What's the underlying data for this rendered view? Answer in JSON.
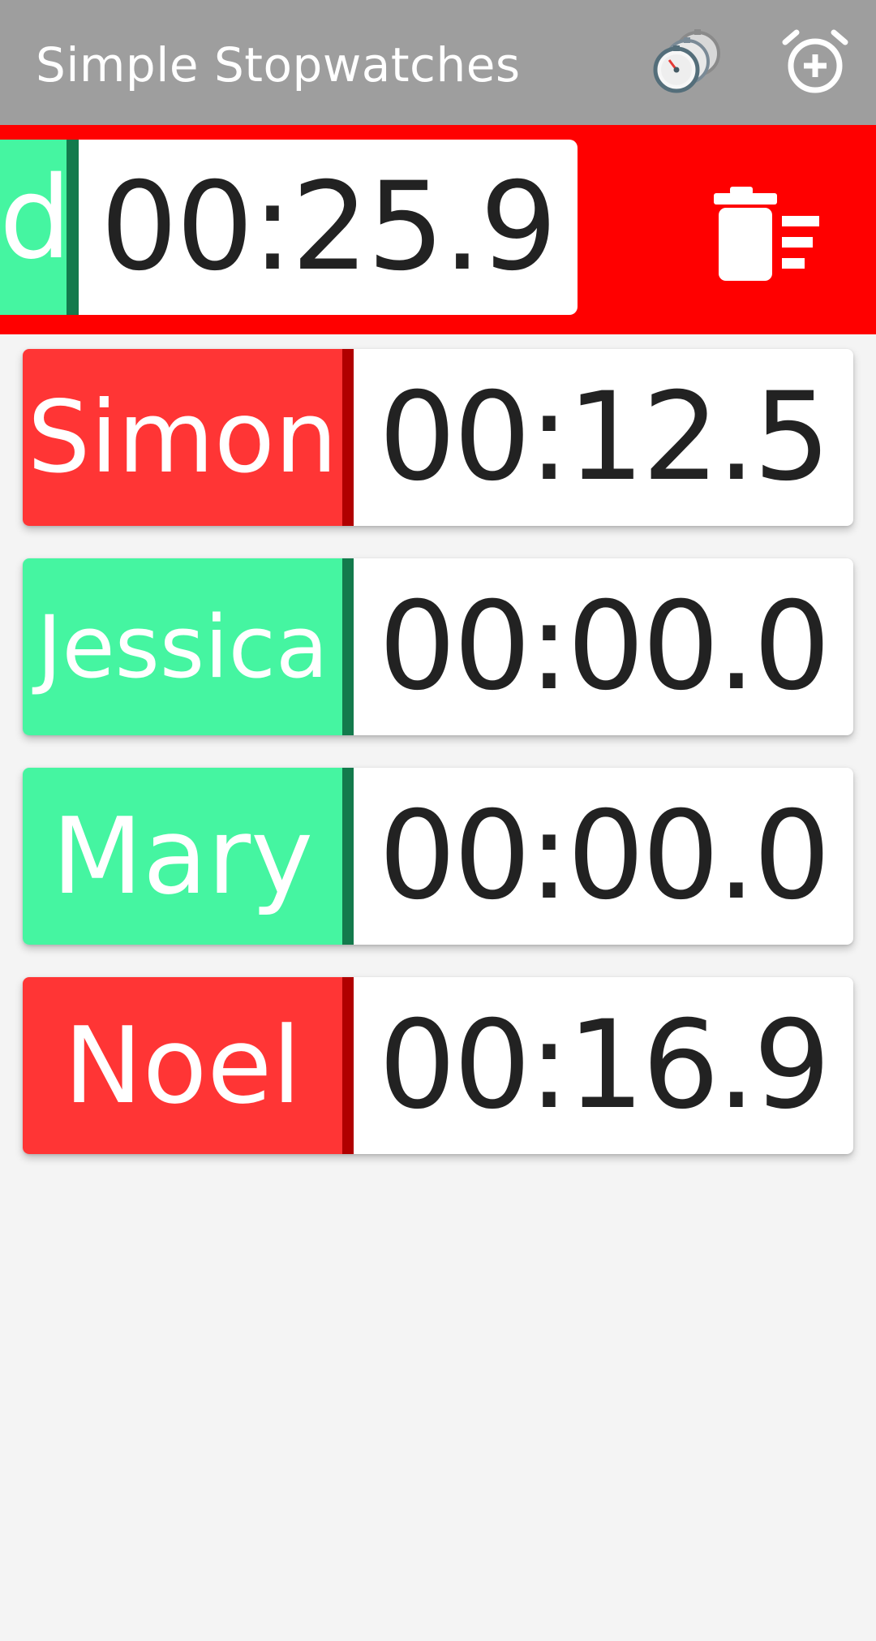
{
  "app": {
    "title": "Simple Stopwatches"
  },
  "actions": {
    "stopwatches_icon": "stacked-stopwatches-icon",
    "add_icon": "add-alarm-icon"
  },
  "swiped_item": {
    "name_fragment": "d",
    "time": "00:25.9",
    "state": "stopped",
    "action_icon": "delete-sweep-icon",
    "action_background": "#ff0000"
  },
  "stopwatches": [
    {
      "name": "Simon",
      "time": "00:12.5",
      "state": "running"
    },
    {
      "name": "Jessica",
      "time": "00:00.0",
      "state": "stopped"
    },
    {
      "name": "Mary",
      "time": "00:00.0",
      "state": "stopped"
    },
    {
      "name": "Noel",
      "time": "00:16.9",
      "state": "running"
    }
  ],
  "colors": {
    "appbar": "#9e9e9e",
    "running": "#ff3535",
    "running_dark": "#b00000",
    "stopped": "#45f5a1",
    "stopped_dark": "#137a4c"
  }
}
